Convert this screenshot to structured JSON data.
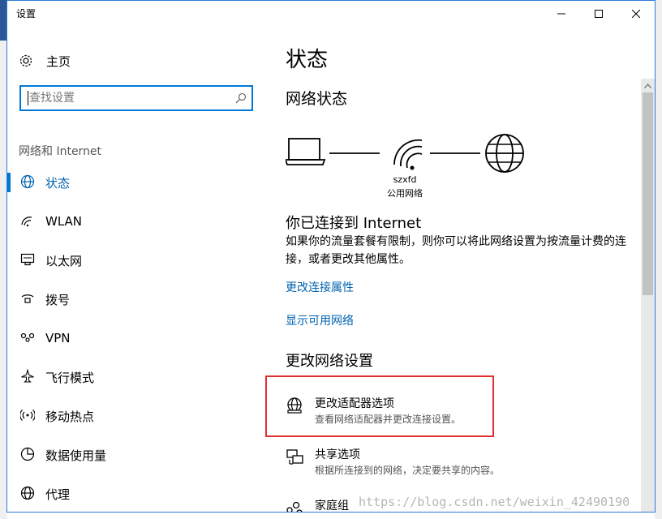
{
  "window": {
    "title": "设置",
    "minimize_icon": "minimize-icon",
    "maximize_icon": "maximize-icon",
    "close_icon": "close-icon"
  },
  "sidebar": {
    "home_label": "主页",
    "search_placeholder": "查找设置",
    "section_title": "网络和 Internet",
    "items": [
      {
        "label": "状态",
        "icon": "globe-icon",
        "active": true
      },
      {
        "label": "WLAN",
        "icon": "wifi-icon"
      },
      {
        "label": "以太网",
        "icon": "ethernet-icon"
      },
      {
        "label": "拨号",
        "icon": "dialup-icon"
      },
      {
        "label": "VPN",
        "icon": "vpn-icon"
      },
      {
        "label": "飞行模式",
        "icon": "airplane-icon"
      },
      {
        "label": "移动热点",
        "icon": "hotspot-icon"
      },
      {
        "label": "数据使用量",
        "icon": "data-usage-icon"
      },
      {
        "label": "代理",
        "icon": "globe-icon"
      }
    ]
  },
  "content": {
    "page_title": "状态",
    "network_status_heading": "网络状态",
    "network_name": "szxfd",
    "network_type": "公用网络",
    "connected_heading": "你已连接到 Internet",
    "connected_desc": "如果你的流量套餐有限制，则你可以将此网络设置为按流量计费的连接，或者更改其他属性。",
    "link_change_properties": "更改连接属性",
    "link_show_networks": "显示可用网络",
    "change_settings_heading": "更改网络设置",
    "options": [
      {
        "title": "更改适配器选项",
        "subtitle": "查看网络适配器并更改连接设置。",
        "icon": "adapter-icon"
      },
      {
        "title": "共享选项",
        "subtitle": "根据所连接到的网络，决定要共享的内容。",
        "icon": "sharing-icon"
      },
      {
        "title": "家庭组",
        "subtitle": "",
        "icon": "homegroup-icon"
      }
    ]
  },
  "watermark": "https://blog.csdn.net/weixin_42490190",
  "colors": {
    "accent": "#0078d7",
    "link": "#0063b1",
    "highlight": "#e03030"
  }
}
